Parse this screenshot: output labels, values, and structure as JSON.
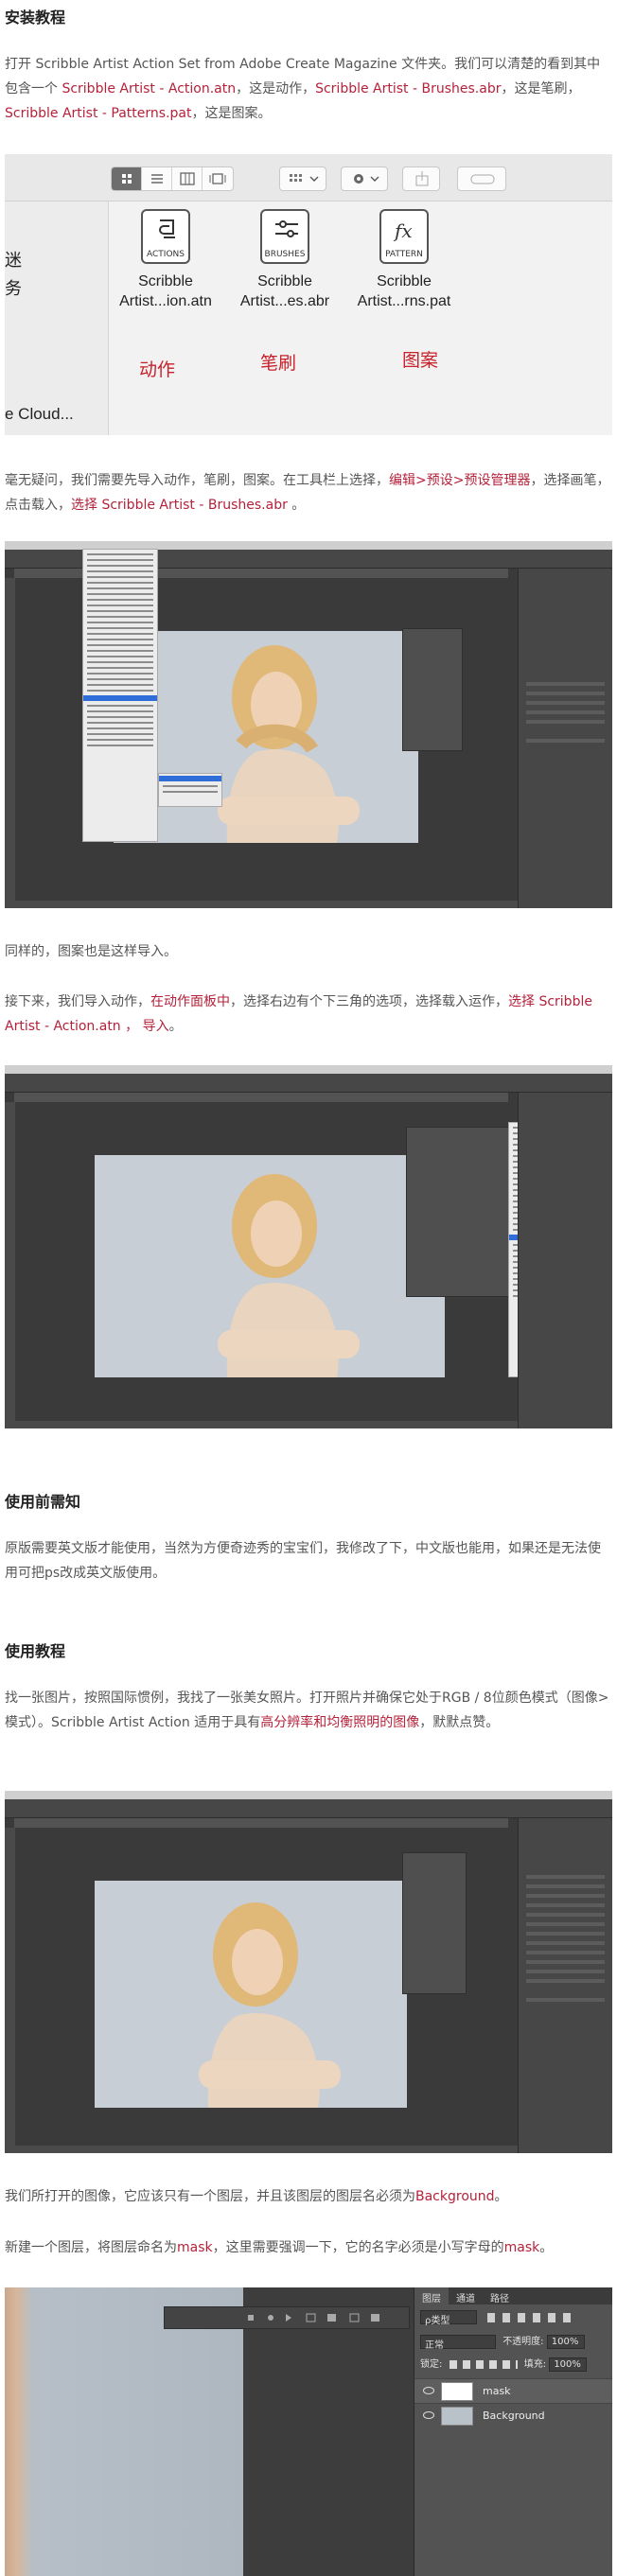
{
  "sections": {
    "install": {
      "heading": "安装教程",
      "p1_a": "打开 Scribble Artist Action Set from Adobe Create Magazine 文件夹。我们可以清楚的看到其中包含一个 ",
      "p1_link1": "Scribble Artist - Action.atn",
      "p1_b": "，这是动作，",
      "p1_link2": "Scribble Artist - Brushes.abr",
      "p1_c": "，这是笔刷，",
      "p1_link3": "Scribble Artist - Patterns.pat",
      "p1_d": "，这是图案。",
      "p2_a": "毫无疑问，我们需要先导入动作，笔刷，图案。在工具栏上选择，",
      "p2_link1": "编辑>预设>预设管理器",
      "p2_b": "，选择画笔，点击载入，",
      "p2_link2": "选择 Scribble Artist - Brushes.abr",
      "p2_c": " 。",
      "p3": "同样的，图案也是这样导入。",
      "p4_a": "接下来，我们导入动作，",
      "p4_link1": "在动作面板中",
      "p4_b": "，选择右边有个下三角的选项，选择载入运作，",
      "p4_link2": "选择 Scribble Artist - Action.atn ， 导入",
      "p4_c": "。"
    },
    "prereq": {
      "heading": "使用前需知",
      "p1": "原版需要英文版才能使用，当然为方便奇迹秀的宝宝们，我修改了下，中文版也能用，如果还是无法使用可把ps改成英文版使用。"
    },
    "usage": {
      "heading": "使用教程",
      "p1_a": "找一张图片，按照国际惯例，我找了一张美女照片。打开照片并确保它处于RGB / 8位颜色模式（图像>模式）。Scribble Artist Action 适用于具有",
      "p1_link": "高分辨率和均衡照明的图像",
      "p1_b": "，默默点赞。",
      "p2_a": "我们所打开的图像，它应该只有一个图层，并且该图层的图层名必须为",
      "p2_link": "Background",
      "p2_b": "。",
      "p3_a": "新建一个图层，将图层命名为",
      "p3_link1": "mask",
      "p3_b": "，这里需要强调一下，它的名字必须是小写字母的",
      "p3_link2": "mask",
      "p3_c": "。"
    }
  },
  "finder": {
    "sidebar_partial_1": "迷",
    "sidebar_partial_2": "务",
    "sidebar_partial_3": "e Cloud...",
    "items": [
      {
        "icon_label": "ACTIONS",
        "name1": "Scribble",
        "name2": "Artist...ion.atn",
        "caption": "动作"
      },
      {
        "icon_label": "BRUSHES",
        "name1": "Scribble",
        "name2": "Artist...es.abr",
        "caption": "笔刷"
      },
      {
        "icon_label": "PATTERN",
        "name1": "Scribble",
        "name2": "Artist...rns.pat",
        "caption": "图案"
      }
    ]
  },
  "layers_panel": {
    "tabs": [
      "图层",
      "通道",
      "路径"
    ],
    "kind_filter": "ρ类型",
    "blend_mode": "正常",
    "opacity_label": "不透明度:",
    "opacity_value": "100%",
    "lock_label": "锁定:",
    "fill_label": "填充:",
    "fill_value": "100%",
    "layers": [
      {
        "name": "mask",
        "selected": true
      },
      {
        "name": "Background",
        "selected": false
      }
    ]
  },
  "colors": {
    "link_red": "#b5213a",
    "finder_caption_red": "#c8202a",
    "ps_dark": "#3a3a3a"
  }
}
